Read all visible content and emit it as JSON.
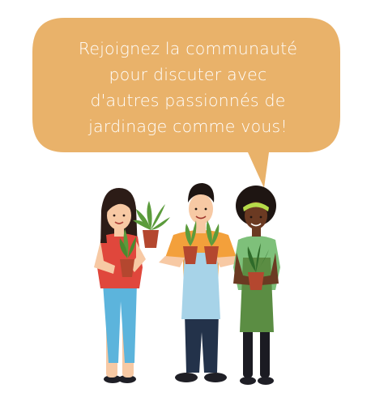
{
  "speech_bubble": {
    "lines": [
      "Rejoignez la communauté",
      "pour discuter avec",
      "d'autres passionnés de",
      "jardinage comme vous!"
    ]
  },
  "colors": {
    "bubble": "#e9b26a",
    "skin_light": "#f7c9a4",
    "skin_dark": "#6b3a22",
    "pot": "#b4472f",
    "leaf": "#5b9b3c",
    "apron_blue": "#a7d3e8",
    "apron_green": "#5b8d43",
    "shirt_red": "#e0473c",
    "shirt_orange": "#f3a03b",
    "shirt_green": "#7ec07a",
    "pants_blue": "#5cb4dc",
    "pants_navy": "#23324a",
    "hair_dark": "#2c1c17",
    "headband": "#b6dc4a"
  }
}
